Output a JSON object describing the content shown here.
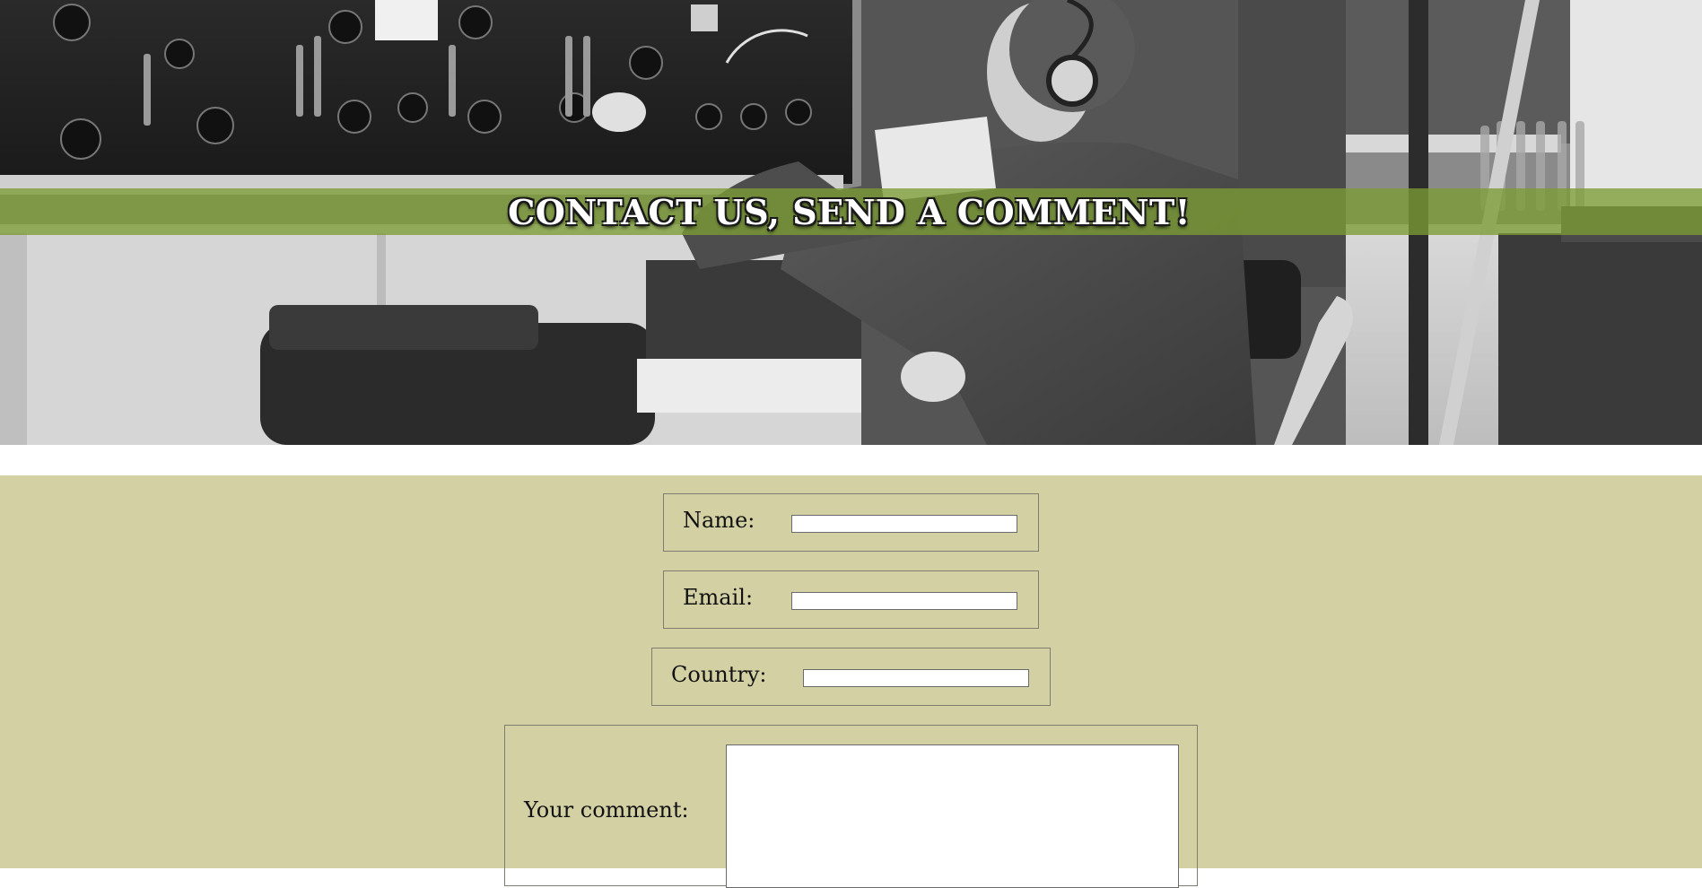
{
  "hero": {
    "title": "CONTACT US, SEND A COMMENT!",
    "image_description_icon": "radio-operator-photo",
    "banner_color": "#7c9c34"
  },
  "form": {
    "background_color": "#d3d1a4",
    "name_label": "Name:",
    "name_value": "",
    "email_label": "Email:",
    "email_value": "",
    "country_label": "Country:",
    "country_value": "",
    "comment_label": "Your comment:",
    "comment_value": ""
  }
}
